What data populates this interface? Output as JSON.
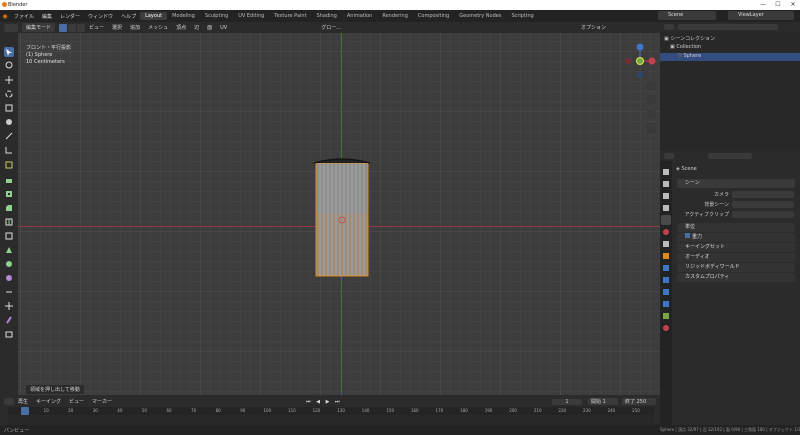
{
  "window": {
    "title": "Blender",
    "min": "—",
    "max": "☐",
    "close": "✕"
  },
  "menu": {
    "items": [
      "ファイル",
      "編集",
      "レンダー",
      "ウィンドウ",
      "ヘルプ"
    ]
  },
  "workspaces": [
    "Layout",
    "Modeling",
    "Sculpting",
    "UV Editing",
    "Texture Paint",
    "Shading",
    "Animation",
    "Rendering",
    "Compositing",
    "Geometry Nodes",
    "Scripting"
  ],
  "active_workspace": "Layout",
  "scene_selector": {
    "value": "Scene"
  },
  "viewlayer_selector": {
    "value": "ViewLayer"
  },
  "viewport_header": {
    "mode": "編集モード",
    "menus": [
      "ビュー",
      "選択",
      "追加",
      "メッシュ",
      "頂点",
      "辺",
      "面",
      "UV"
    ],
    "orientation": "グロー...",
    "options": "オプション"
  },
  "viewport_info": {
    "line1": "フロント・平行投影",
    "line2": "(1) Sphere",
    "line3": "10 Centimeters"
  },
  "operator_panel": {
    "label": "領域を押し出して移動"
  },
  "timeline": {
    "menus": [
      "再生",
      "キーイング",
      "ビュー",
      "マーカー"
    ],
    "current_frame": "1",
    "start_label": "開始",
    "start": "1",
    "end_label": "終了",
    "end": "250",
    "ticks": [
      "1",
      "10",
      "20",
      "30",
      "40",
      "50",
      "60",
      "70",
      "80",
      "90",
      "100",
      "110",
      "120",
      "130",
      "140",
      "150",
      "160",
      "170",
      "180",
      "190",
      "200",
      "210",
      "220",
      "230",
      "240",
      "250"
    ]
  },
  "statusbar": {
    "left": "パンビュー",
    "right": "Sphere | 頂点 32/97 | 辺 32/192 | 面 0/96 | 三角面 180 | オブジェクト 1/3 | 3.2.0"
  },
  "outliner": {
    "title": "シーンコレクション",
    "collection": "Collection",
    "object": "Sphere"
  },
  "properties": {
    "object": "Scene",
    "section": "シーン",
    "camera_label": "カメラ",
    "bg_scene_label": "背景シーン",
    "active_clip_label": "アクティブクリップ",
    "panels": [
      "単位",
      "重力",
      "キーイングセット",
      "オーディオ",
      "リジッドボディワールド",
      "カスタムプロパティ"
    ]
  },
  "colors": {
    "accent": "#4a6fa5",
    "x_axis": "#c4414d",
    "y_axis": "#78a74a",
    "z_axis": "#3f76c7",
    "selection": "#e08a1e"
  }
}
